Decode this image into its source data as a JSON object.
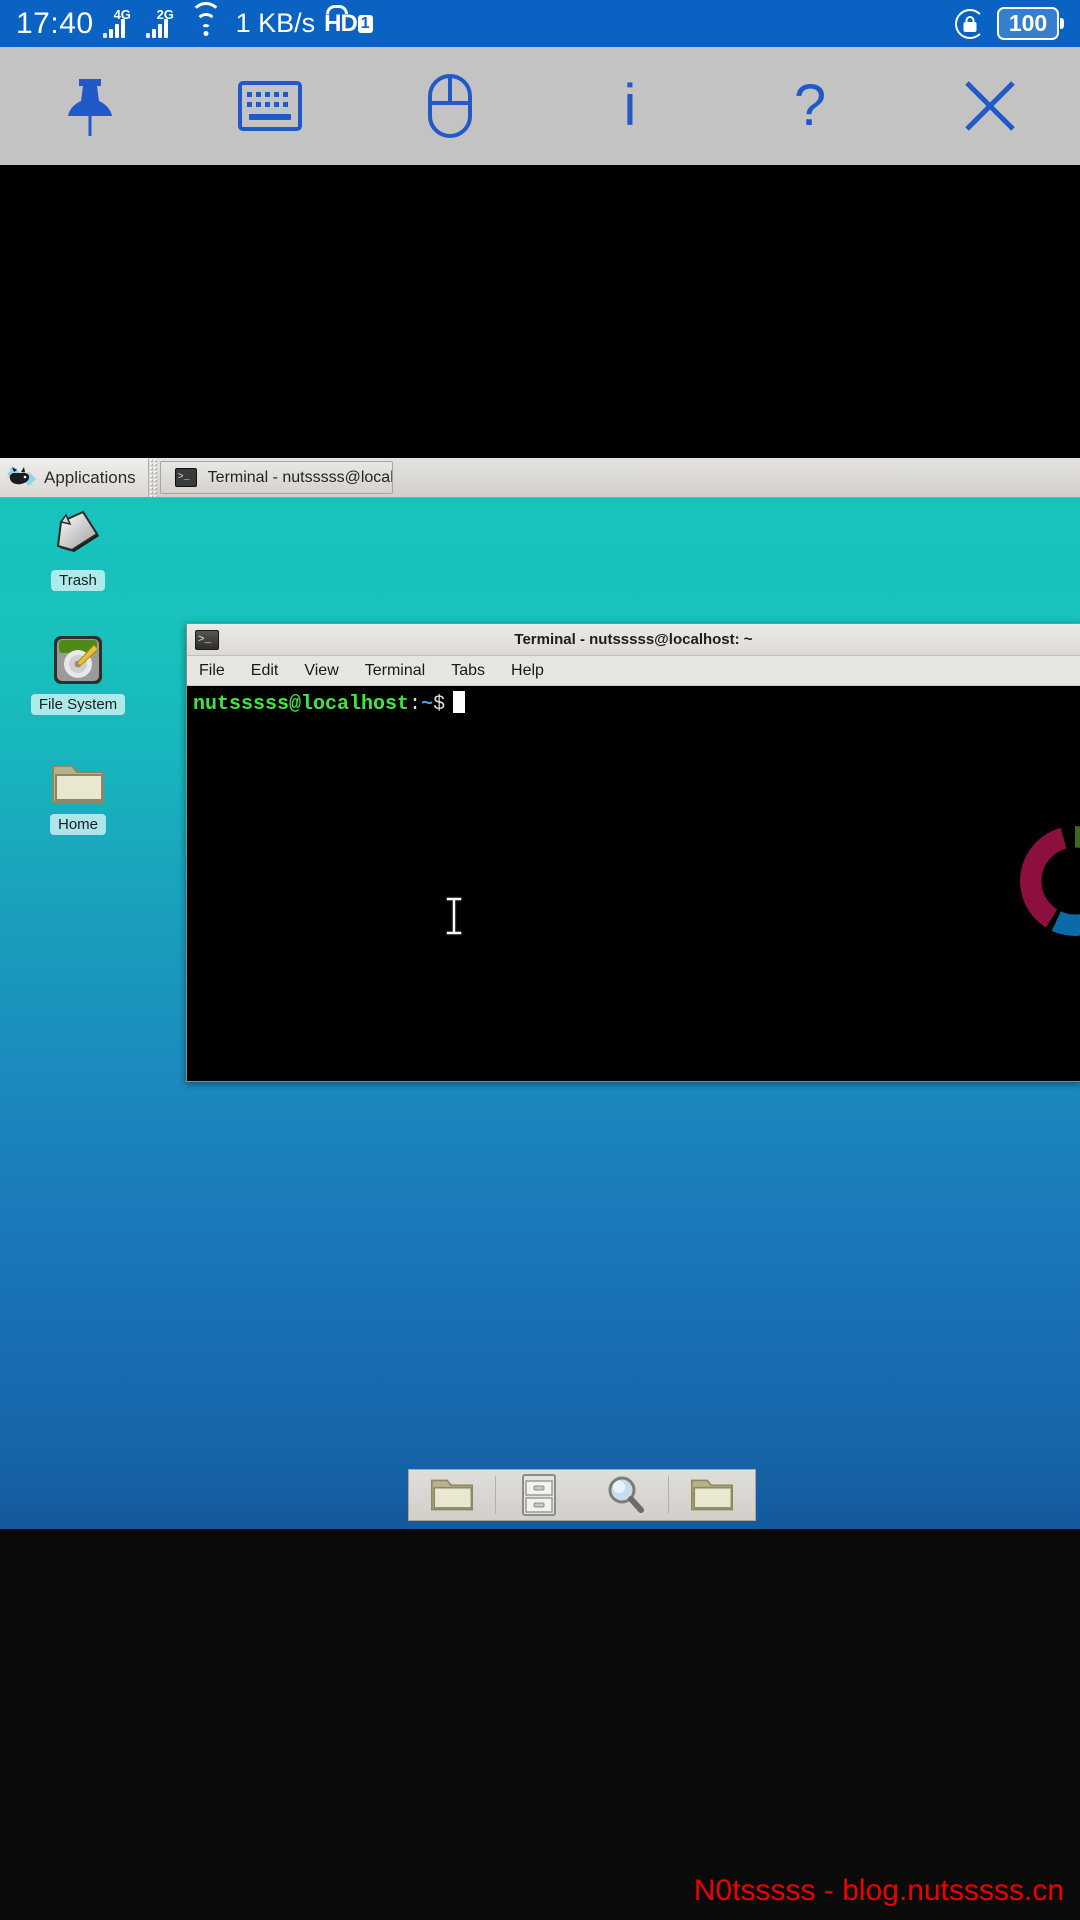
{
  "status_bar": {
    "time": "17:40",
    "network_speed": "1 KB/s",
    "signals": [
      {
        "generation": "4G",
        "name": "signal-bars-4g"
      },
      {
        "generation": "2G",
        "name": "signal-bars-2g"
      }
    ],
    "wifi_icon": "wifi-icon",
    "volte_label": "HD",
    "volte_sim": "1",
    "rotation_lock_icon": "rotation-lock-icon",
    "battery_level": "100",
    "background_color": "#0a63c2",
    "text_color": "#ffffff"
  },
  "toolbar": {
    "accent_color": "#2159c9",
    "background_color": "#c3c3c3",
    "buttons": [
      {
        "name": "pin-icon",
        "label": "Pin"
      },
      {
        "name": "keyboard-icon",
        "label": "Keyboard"
      },
      {
        "name": "mouse-icon",
        "label": "Mouse"
      },
      {
        "name": "info-icon",
        "label": "i"
      },
      {
        "name": "help-icon",
        "label": "?"
      },
      {
        "name": "close-icon",
        "label": "X"
      }
    ]
  },
  "xfce_panel": {
    "applications_label": "Applications",
    "window_buttons": [
      {
        "title": "Terminal - nutsssss@localhost: ~",
        "icon": "terminal-icon"
      }
    ]
  },
  "desktop": {
    "icons": [
      {
        "label": "Trash",
        "icon": "trash-icon"
      },
      {
        "label": "File System",
        "icon": "harddisk-icon"
      },
      {
        "label": "Home",
        "icon": "folder-icon"
      }
    ]
  },
  "terminal_window": {
    "title": "Terminal - nutsssss@localhost: ~",
    "menu_items": [
      "File",
      "Edit",
      "View",
      "Terminal",
      "Tabs",
      "Help"
    ],
    "prompt_user_host": "nutsssss@localhost",
    "prompt_separator": ":",
    "prompt_path": "~",
    "prompt_symbol": "$",
    "cursor": "block",
    "colors": {
      "background": "#000000",
      "prompt_green": "#3ee63e",
      "path_blue": "#4a9fe8",
      "cursor": "#ffffff"
    },
    "decoration": {
      "name": "donut-ring-graphic",
      "segments": [
        "#3d6b1c",
        "#9a7208",
        "#0b6ba8",
        "#8c0f3d"
      ]
    }
  },
  "dock": {
    "items": [
      {
        "name": "folder-icon",
        "label": "File Manager"
      },
      {
        "name": "file-cabinet-icon",
        "label": "File Cabinet"
      },
      {
        "name": "search-icon",
        "label": "Find Files"
      },
      {
        "name": "folder-icon",
        "label": "Folder"
      }
    ]
  },
  "watermark": {
    "text": "N0tsssss - blog.nutsssss.cn",
    "color": "#ef0000"
  }
}
